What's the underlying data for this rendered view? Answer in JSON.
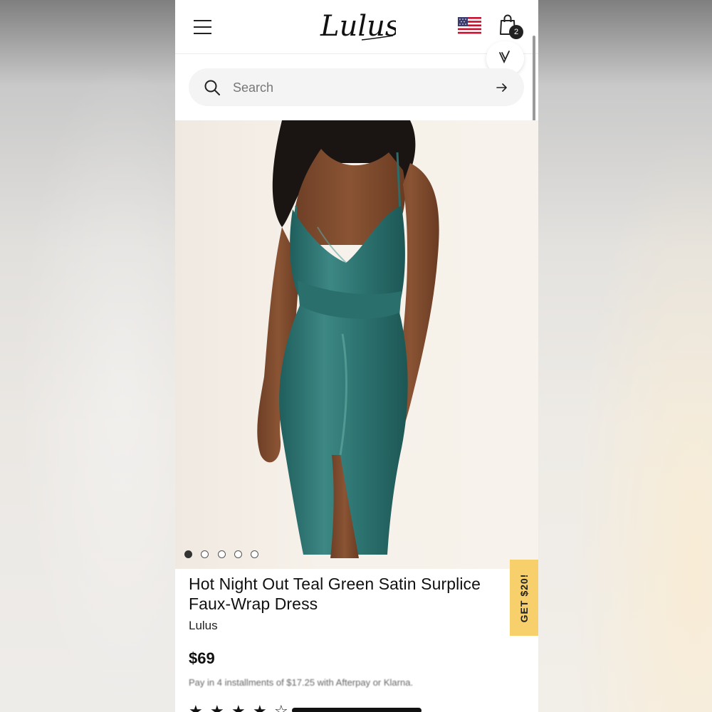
{
  "header": {
    "logo_text": "Lulus",
    "cart_count": "2",
    "region_flag": "us-flag-icon"
  },
  "search": {
    "placeholder": "Search",
    "value": ""
  },
  "gallery": {
    "total_images": 5,
    "active_index": 0
  },
  "product": {
    "title": "Hot Night Out Teal Green Satin Surplice Faux-Wrap Dress",
    "brand": "Lulus",
    "price": "$69",
    "installments": "Pay in 4 installments of $17.25 with Afterpay or Klarna.",
    "rating": 4.5
  },
  "promo": {
    "label": "GET $20!"
  },
  "colors": {
    "dress_teal": "#2f7a78",
    "promo_yellow": "#f7cf6b",
    "text_primary": "#111111"
  },
  "icons": [
    "menu-icon",
    "us-flag-icon",
    "shopping-bag-icon",
    "search-icon",
    "arrow-right-icon"
  ]
}
